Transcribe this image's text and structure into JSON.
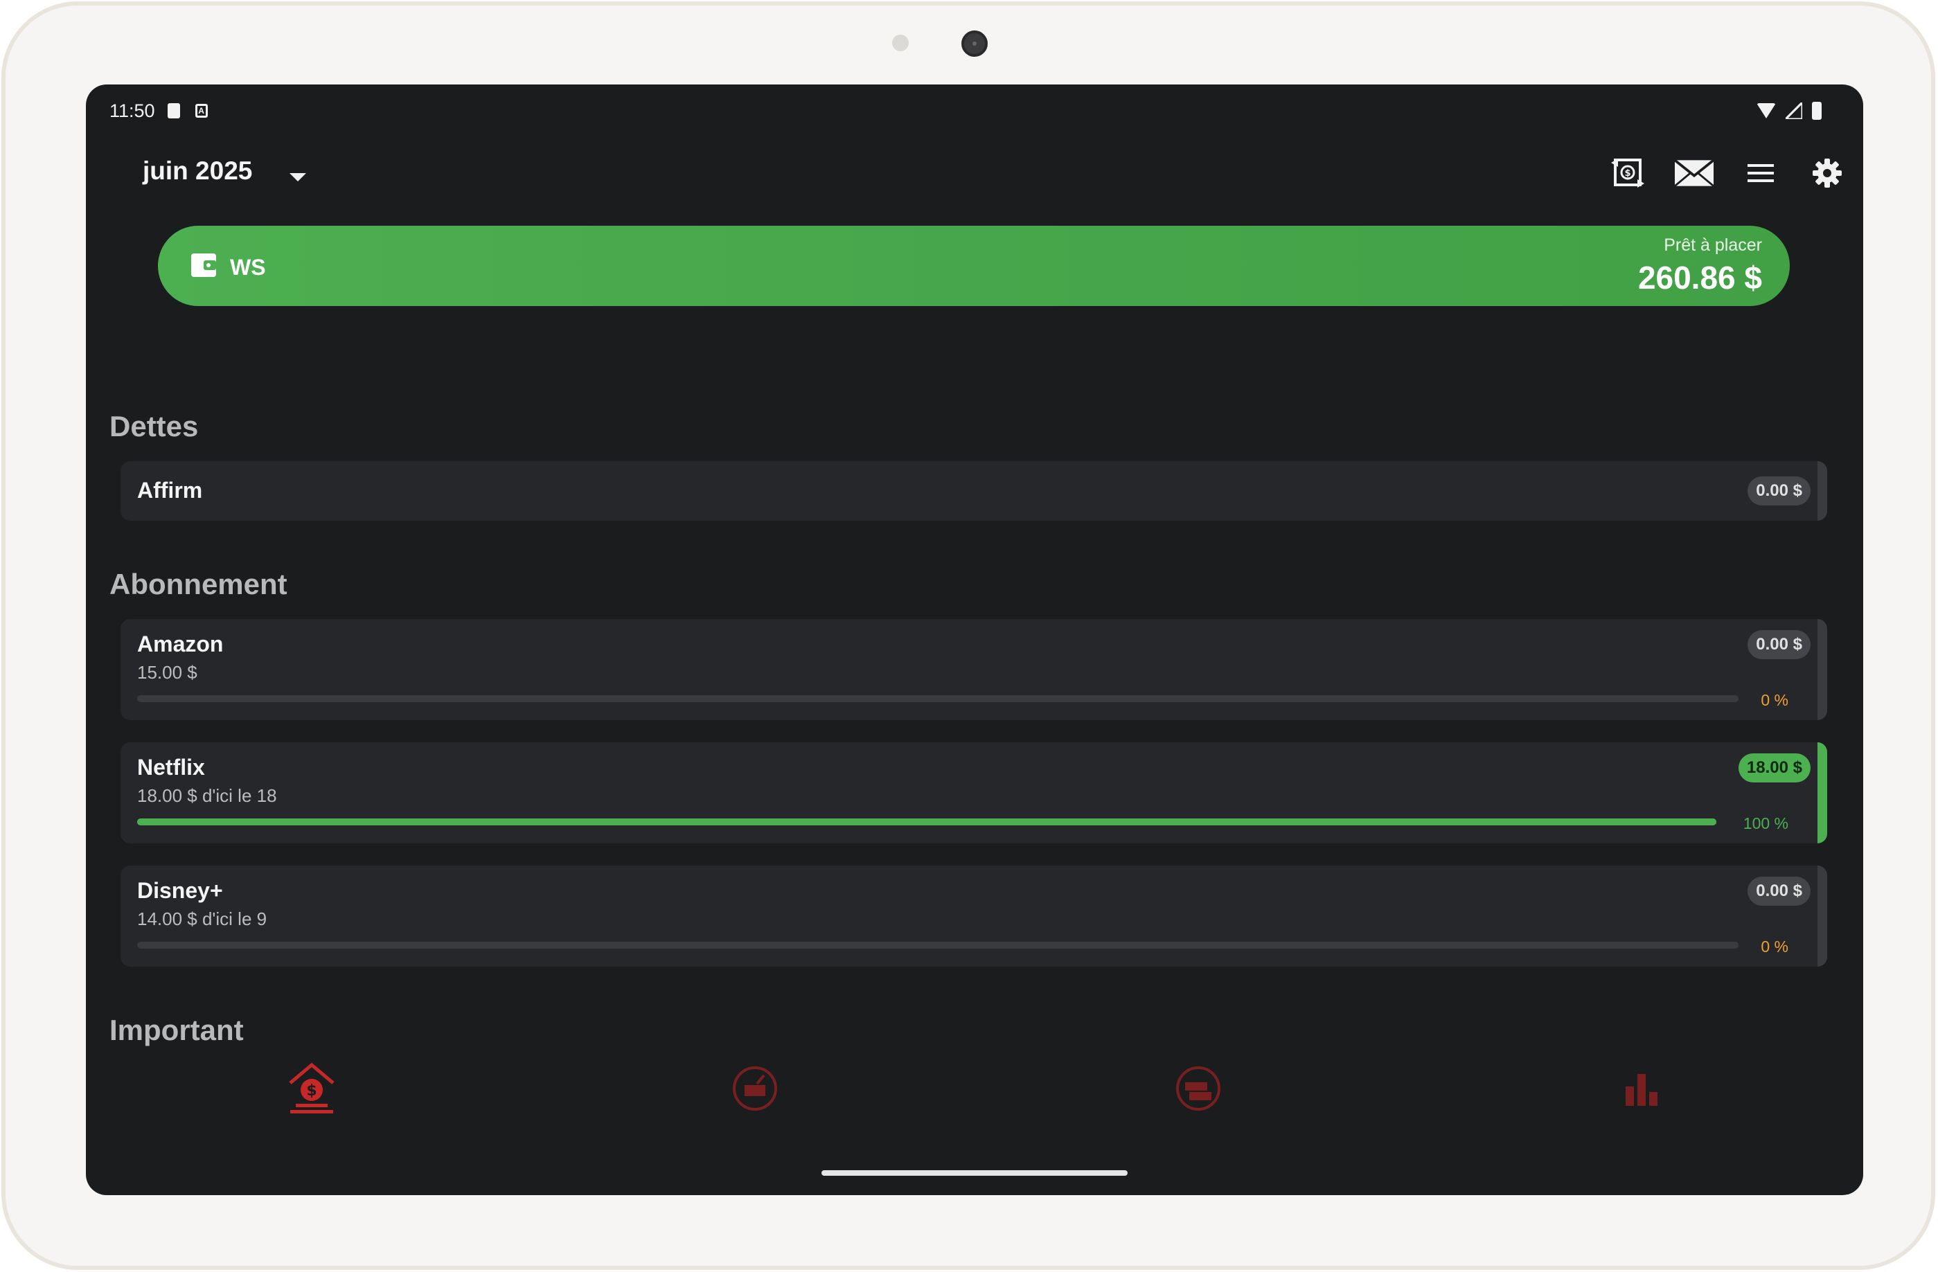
{
  "status_bar": {
    "time": "11:50"
  },
  "header": {
    "month": "juin 2025"
  },
  "wallet": {
    "name": "WS",
    "ready_label": "Prêt à placer",
    "amount": "260.86 $"
  },
  "sections": {
    "debts": {
      "title": "Dettes",
      "items": [
        {
          "name": "Affirm",
          "badge": "0.00 $"
        }
      ]
    },
    "subscription": {
      "title": "Abonnement",
      "items": [
        {
          "name": "Amazon",
          "detail": "15.00 $",
          "badge": "0.00 $",
          "progress": 0,
          "percent": "0 %"
        },
        {
          "name": "Netflix",
          "detail": "18.00 $ d'ici le 18",
          "badge": "18.00 $",
          "progress": 100,
          "percent": "100 %"
        },
        {
          "name": "Disney+",
          "detail": "14.00 $ d'ici le 9",
          "badge": "0.00 $",
          "progress": 0,
          "percent": "0 %"
        }
      ]
    },
    "important": {
      "title": "Important"
    }
  },
  "icons": {
    "header": [
      "exchange-money-icon",
      "envelope-icon",
      "menu-icon",
      "settings-icon"
    ],
    "nav": [
      "budget-home-icon",
      "transactions-icon",
      "accounts-icon",
      "reports-chart-icon"
    ]
  },
  "colors": {
    "accent": "#4caf50",
    "nav_active": "#c62828",
    "nav_inactive": "#7a1f1f",
    "warning": "#f0a030"
  }
}
